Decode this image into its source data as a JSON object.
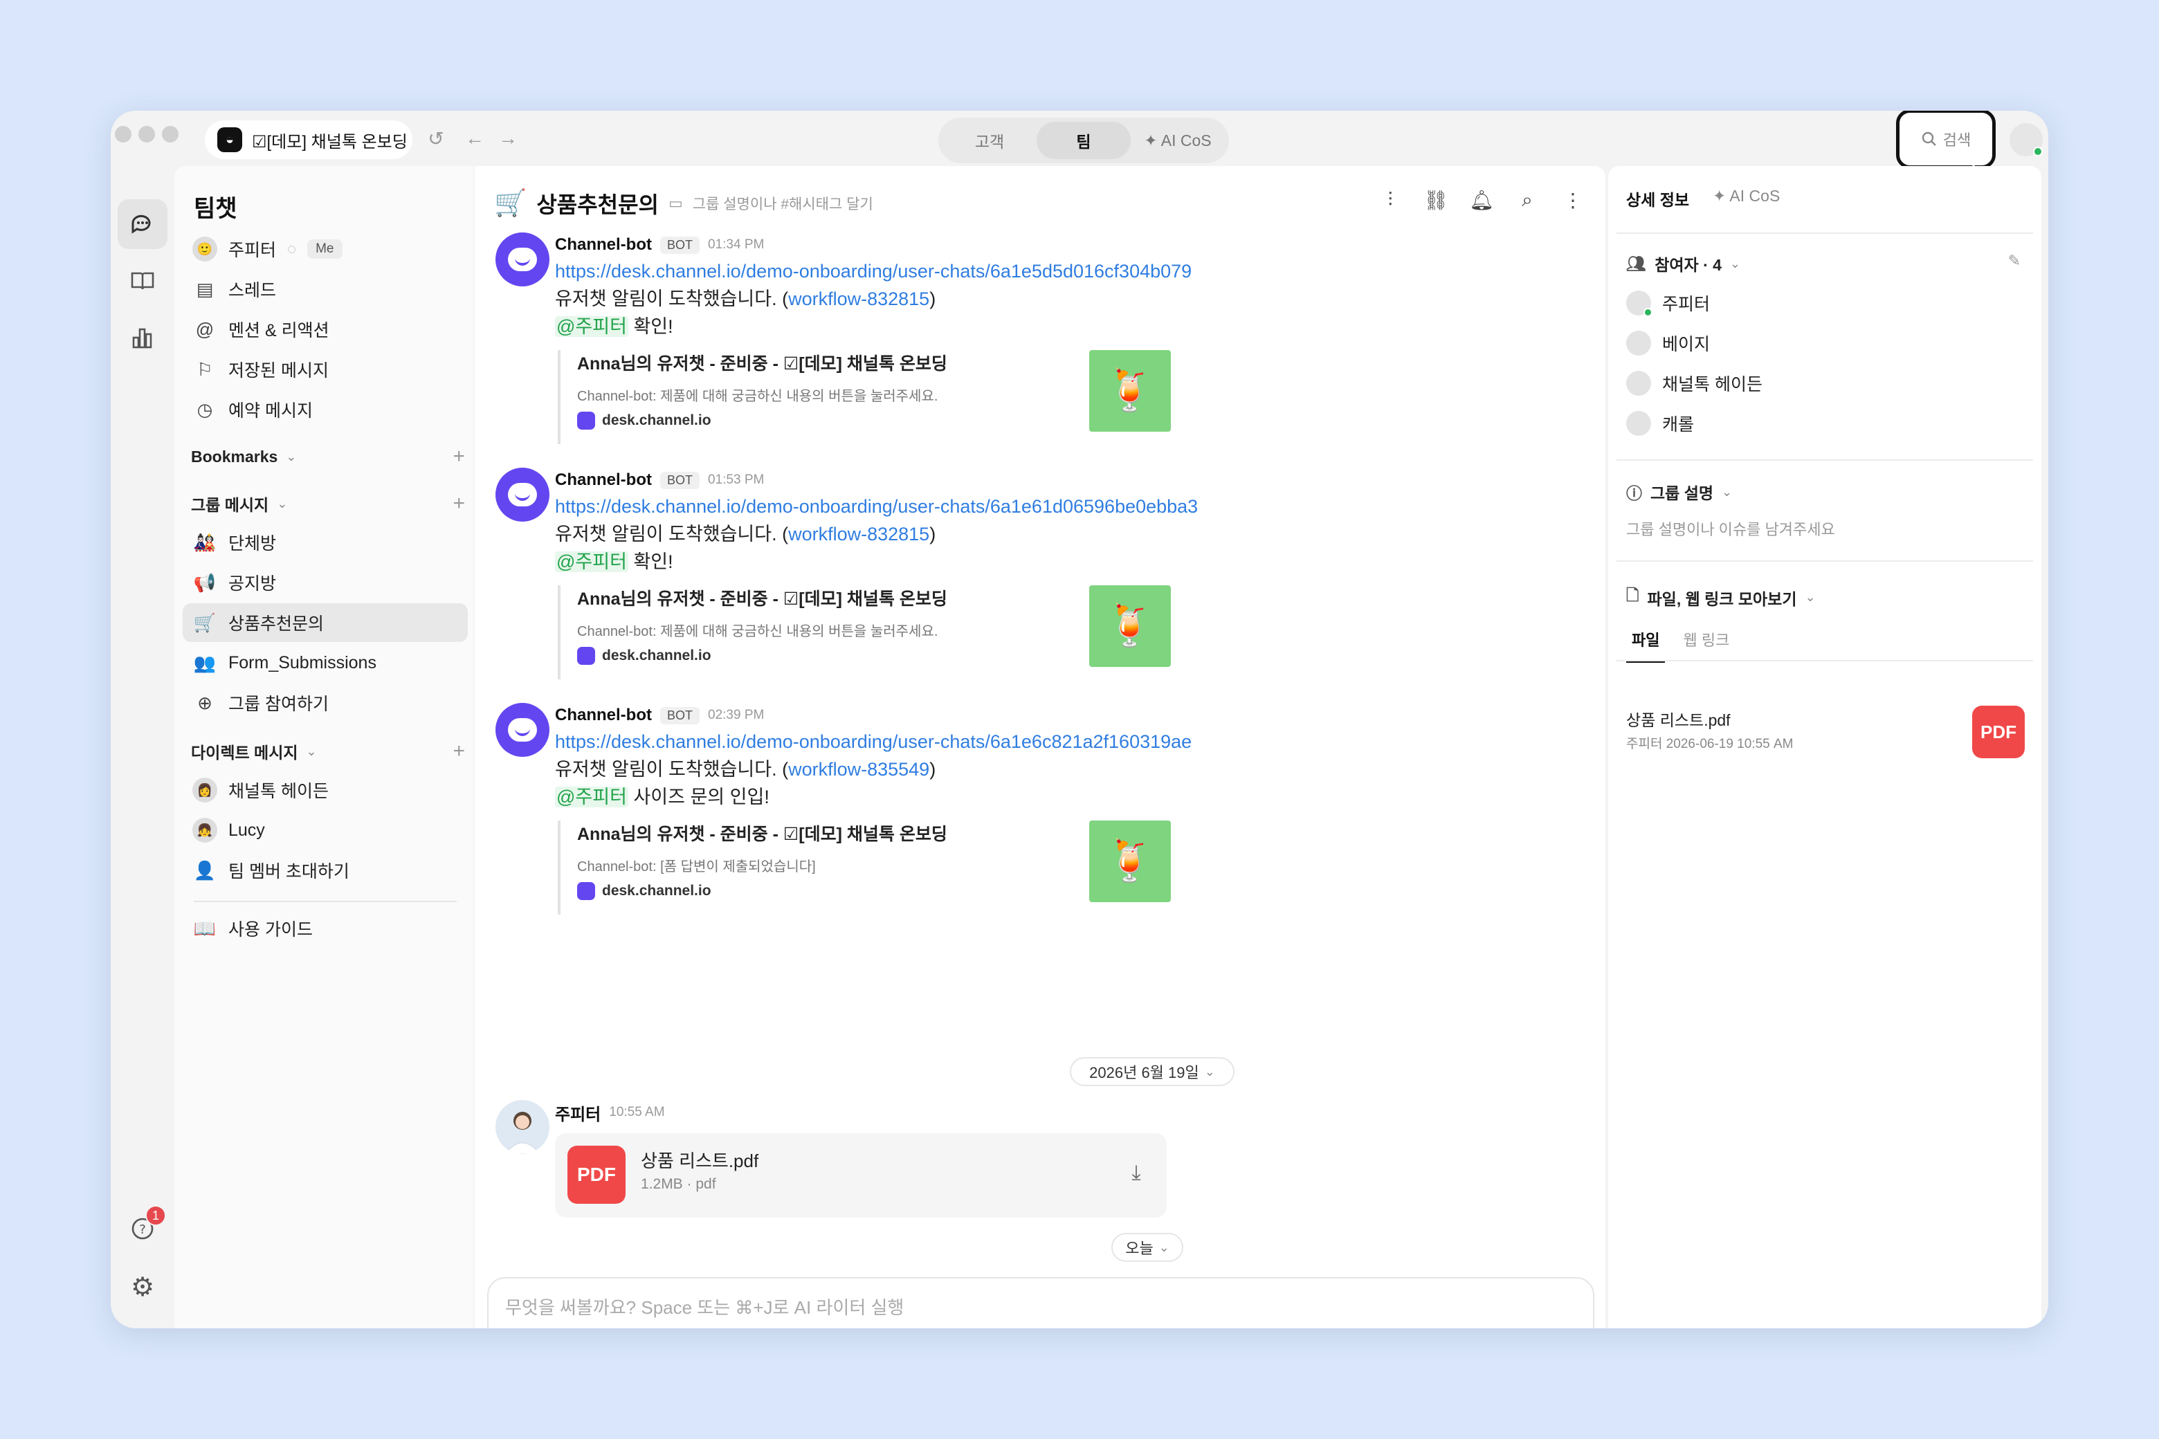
{
  "titlebar": {
    "tab_title": "☑[데모] 채널톡 온보딩",
    "segments": [
      "고객",
      "팀",
      "✦ AI CoS"
    ],
    "active_segment": "팀",
    "search_label": "검색"
  },
  "sidebar": {
    "title": "팀챗",
    "top_items": [
      {
        "label": "주피터",
        "badge": "Me"
      },
      {
        "label": "스레드"
      },
      {
        "label": "멘션 & 리액션"
      },
      {
        "label": "저장된 메시지"
      },
      {
        "label": "예약 메시지"
      }
    ],
    "bookmarks_label": "Bookmarks",
    "group_label": "그룹 메시지",
    "groups": [
      {
        "label": "단체방",
        "icon": "🎎"
      },
      {
        "label": "공지방",
        "icon": "📢"
      },
      {
        "label": "상품추천문의",
        "icon": "🛒",
        "selected": true
      },
      {
        "label": "Form_Submissions",
        "icon": "👥"
      },
      {
        "label": "그룹 참여하기",
        "icon": "⊕"
      }
    ],
    "dm_label": "다이렉트 메시지",
    "dms": [
      {
        "label": "채널톡 헤이든"
      },
      {
        "label": "Lucy"
      },
      {
        "label": "팀 멤버 초대하기"
      }
    ],
    "guide_label": "사용 가이드",
    "help_badge": "1"
  },
  "chat": {
    "title": "상품추천문의",
    "description": "그룹 설명이나 #해시태그 달기",
    "messages": [
      {
        "name": "Channel-bot",
        "tag": "BOT",
        "time": "01:34 PM",
        "link": "https://desk.channel.io/demo-onboarding/user-chats/6a1e5d5d016cf304b079",
        "text_pre": "유저챗 알림이 도착했습니다. (",
        "workflow": "workflow-832815",
        "text_post": ")",
        "mention": "@주피터",
        "mention_text": " 확인!",
        "card_title": "Anna님의 유저챗 - 준비중 - ☑[데모] 채널톡 온보딩",
        "card_desc": "Channel-bot: 제품에 대해 궁금하신 내용의 버튼을 눌러주세요.",
        "card_src": "desk.channel.io"
      },
      {
        "name": "Channel-bot",
        "tag": "BOT",
        "time": "01:53 PM",
        "link": "https://desk.channel.io/demo-onboarding/user-chats/6a1e61d06596be0ebba3",
        "text_pre": "유저챗 알림이 도착했습니다. (",
        "workflow": "workflow-832815",
        "text_post": ")",
        "mention": "@주피터",
        "mention_text": " 확인!",
        "card_title": "Anna님의 유저챗 - 준비중 - ☑[데모] 채널톡 온보딩",
        "card_desc": "Channel-bot: 제품에 대해 궁금하신 내용의 버튼을 눌러주세요.",
        "card_src": "desk.channel.io"
      },
      {
        "name": "Channel-bot",
        "tag": "BOT",
        "time": "02:39 PM",
        "link": "https://desk.channel.io/demo-onboarding/user-chats/6a1e6c821a2f160319ae",
        "text_pre": "유저챗 알림이 도착했습니다. (",
        "workflow": "workflow-835549",
        "text_post": ")",
        "mention": "@주피터",
        "mention_text": " 사이즈 문의 인입!",
        "card_title": "Anna님의 유저챗 - 준비중 - ☑[데모] 채널톡 온보딩",
        "card_desc": "Channel-bot: [폼 답변이 제출되었습니다]",
        "card_src": "desk.channel.io"
      }
    ],
    "date_divider": "2026년 6월 19일",
    "user_message": {
      "name": "주피터",
      "time": "10:55 AM",
      "file_name": "상품 리스트.pdf",
      "file_meta": "1.2MB · pdf",
      "file_type": "PDF"
    },
    "today_label": "오늘",
    "composer_placeholder": "무엇을 써볼까요? Space 또는 ⌘+J로 AI 라이터 실행"
  },
  "rpanel": {
    "tabs": [
      "상세 정보",
      "✦ AI CoS"
    ],
    "participants_label": "참여자 · 4",
    "participants": [
      "주피터",
      "베이지",
      "채널톡 헤이든",
      "캐롤"
    ],
    "group_desc_label": "그룹 설명",
    "group_desc_placeholder": "그룹 설명이나 이슈를 남겨주세요",
    "files_label": "파일, 웹 링크 모아보기",
    "file_tabs": [
      "파일",
      "웹 링크"
    ],
    "file": {
      "name": "상품 리스트.pdf",
      "meta": "주피터  2026-06-19 10:55 AM",
      "type": "PDF"
    }
  },
  "colors": {
    "accent_purple": "#6446f0",
    "link": "#2f7de1",
    "mention_green": "#22a34a",
    "pdf_red": "#f04848"
  }
}
